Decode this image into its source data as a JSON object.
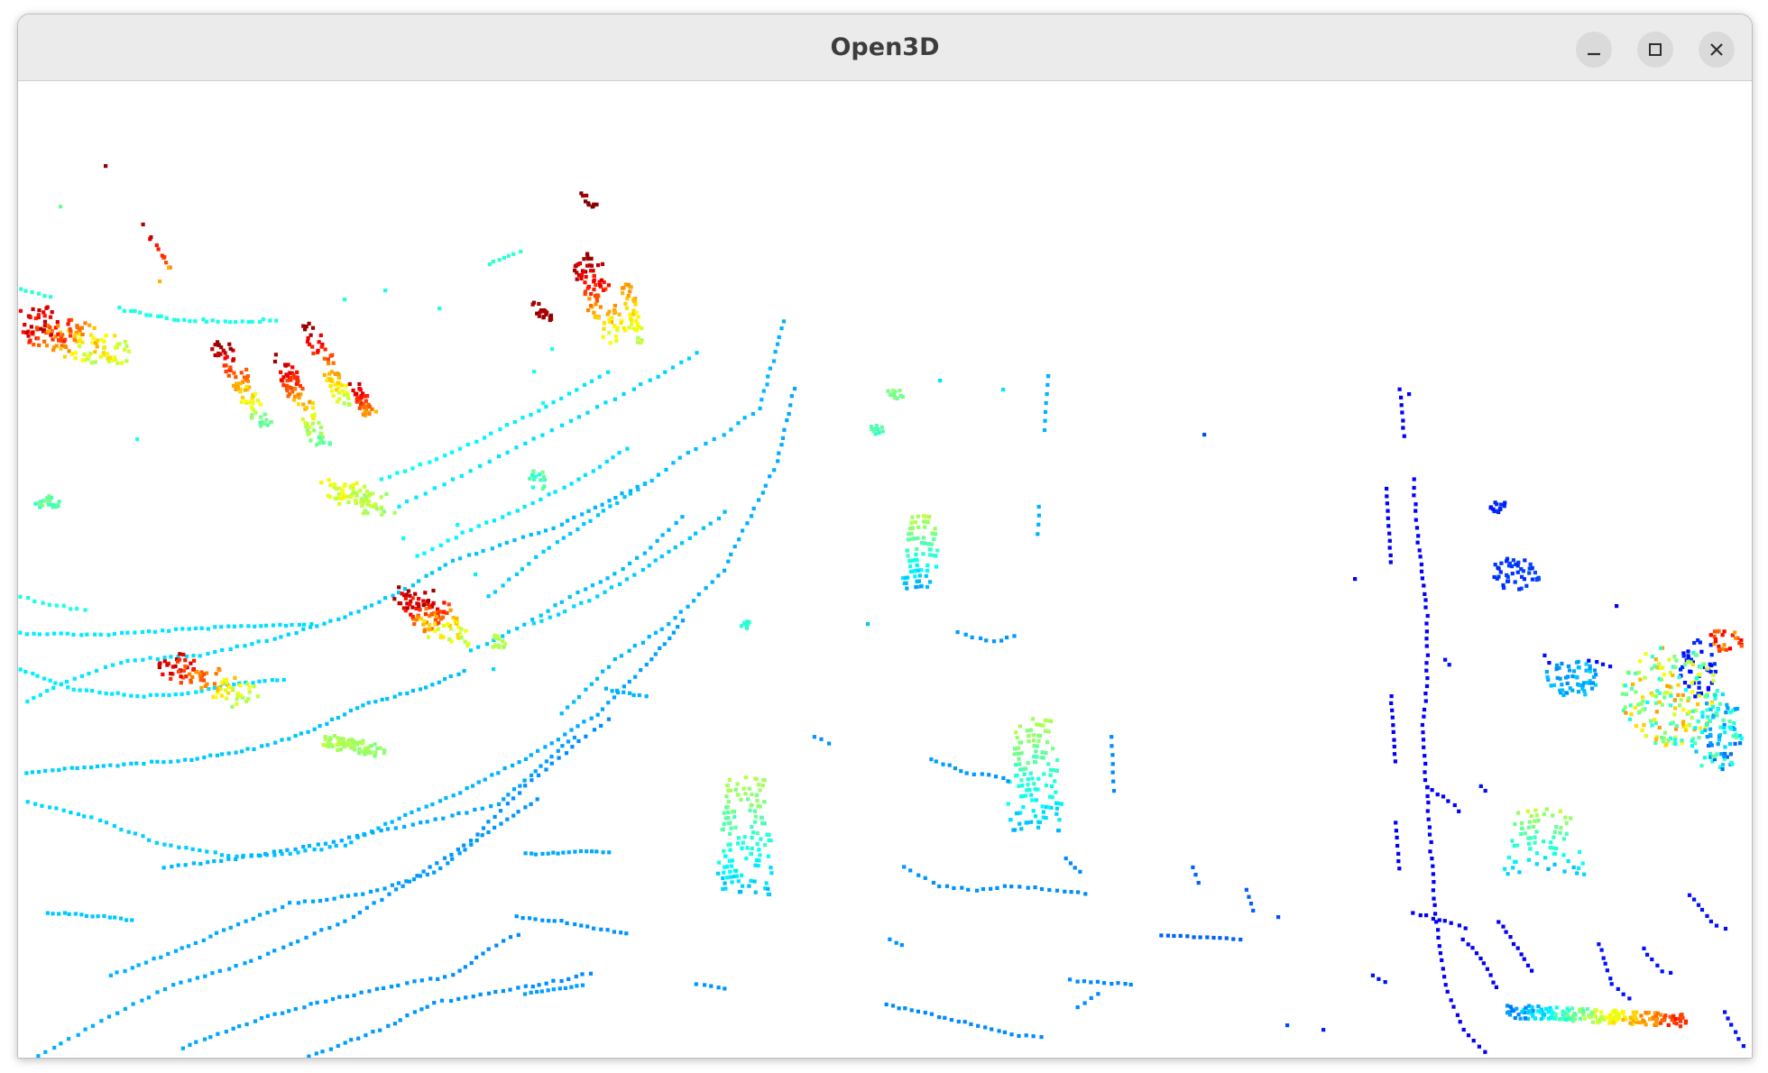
{
  "window": {
    "title": "Open3D",
    "controls": {
      "minimize_icon": "minimize-icon",
      "maximize_icon": "maximize-icon",
      "close_icon": "close-icon"
    }
  },
  "viewport": {
    "background": "#ffffff",
    "colormap": "jet",
    "colors": {
      "near": "#0a1ee6",
      "mid_blue": "#1e78f0",
      "cyan": "#28c8f0",
      "green": "#78f078",
      "yellow": "#f0f028",
      "orange": "#f08c14",
      "red": "#c80a0a"
    }
  }
}
